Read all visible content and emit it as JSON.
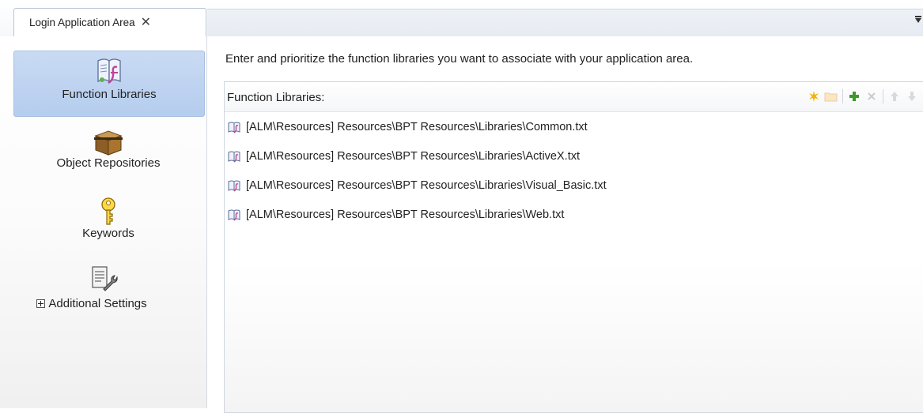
{
  "tab": {
    "title": "Login Application Area",
    "close_glyph": "✕"
  },
  "nav": {
    "items": [
      {
        "label": "Function Libraries",
        "icon": "function-library-icon",
        "selected": true
      },
      {
        "label": "Object Repositories",
        "icon": "repository-box-icon"
      },
      {
        "label": "Keywords",
        "icon": "key-icon"
      },
      {
        "label": "Additional Settings",
        "icon": "settings-icon",
        "expandable": true
      }
    ]
  },
  "main": {
    "instruction": "Enter and prioritize the function libraries you want to associate with your application area.",
    "panel_title": "Function Libraries:",
    "toolbar": [
      {
        "icon": "new-icon",
        "enabled": true
      },
      {
        "icon": "open-folder-icon",
        "enabled": false
      },
      {
        "icon": "add-icon",
        "enabled": true
      },
      {
        "icon": "delete-icon",
        "enabled": false
      },
      {
        "icon": "move-up-icon",
        "enabled": false
      },
      {
        "icon": "move-down-icon",
        "enabled": false
      }
    ],
    "libraries": [
      "[ALM\\Resources] Resources\\BPT Resources\\Libraries\\Common.txt",
      "[ALM\\Resources] Resources\\BPT Resources\\Libraries\\ActiveX.txt",
      "[ALM\\Resources] Resources\\BPT Resources\\Libraries\\Visual_Basic.txt",
      "[ALM\\Resources] Resources\\BPT Resources\\Libraries\\Web.txt"
    ]
  },
  "colors": {
    "selection": "#b5cdee",
    "accent_star": "#f5b400",
    "accent_add": "#3a9a2a"
  }
}
